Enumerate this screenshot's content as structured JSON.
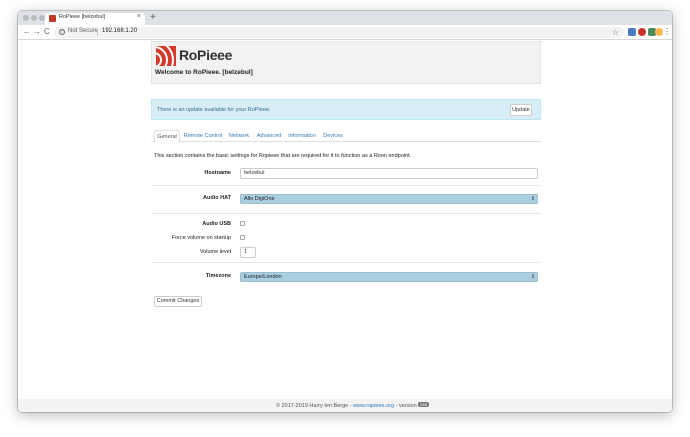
{
  "browser": {
    "tab_title": "RoPieee [belzebul]",
    "tab_close": "×",
    "new_tab": "+",
    "back": "←",
    "forward": "→",
    "reload": "C",
    "security_label": "Not Secure",
    "url": "192.168.1.20",
    "star": "☆",
    "menu": "⋮",
    "extension_colors": [
      "#4b79c7",
      "#c9302c",
      "#4a8c5a",
      "#ffb74d"
    ]
  },
  "header": {
    "brand": "RoPieee",
    "welcome": "Welcome to RoPieee. [belzebul]",
    "brand_color": "#d23a2a"
  },
  "alert": {
    "message": "There is an update available for your RoPieee.",
    "update_label": "Update"
  },
  "tabs": [
    {
      "label": "General",
      "active": true
    },
    {
      "label": "Remote Control",
      "active": false
    },
    {
      "label": "Network",
      "active": false
    },
    {
      "label": "Advanced",
      "active": false
    },
    {
      "label": "Information",
      "active": false
    },
    {
      "label": "Devices",
      "active": false
    }
  ],
  "general": {
    "intro": "This section contains the basic settings for Ropieee that are required for it to function as a Roon endpoint.",
    "hostname_label": "Hostname",
    "hostname_value": "belzebul",
    "audio_hat_label": "Audio HAT",
    "audio_hat_value": "Allo DigiOne",
    "audio_usb_label": "Audio USB",
    "audio_usb_checked": false,
    "force_volume_label": "Force volume on startup",
    "force_volume_checked": false,
    "volume_level_label": "Volume level",
    "volume_level_value": "1",
    "timezone_label": "Timezone",
    "timezone_value": "Europe/London",
    "commit_label": "Commit Changes"
  },
  "footer": {
    "copyright": "© 2017-2019 Harry ten Berge - ",
    "site_link": "www.ropieee.org",
    "version_prefix": " - version ",
    "version": "255"
  }
}
